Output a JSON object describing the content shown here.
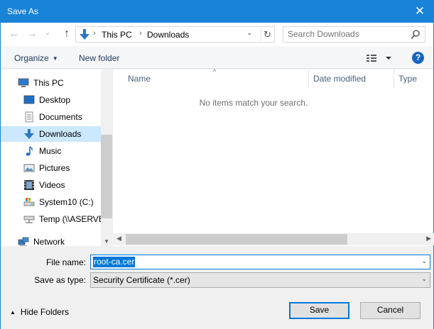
{
  "window": {
    "title": "Save As",
    "close_glyph": "✕"
  },
  "nav": {
    "back_glyph": "←",
    "forward_glyph": "→",
    "recent_glyph": "⌄",
    "up_glyph": "↑",
    "breadcrumbs": [
      "This PC",
      "Downloads"
    ],
    "breadcrumb_sep": "›",
    "dropdown_glyph": "⌄",
    "refresh_glyph": "↻"
  },
  "search": {
    "placeholder": "Search Downloads"
  },
  "toolbar": {
    "organize_label": "Organize",
    "caret": "▼",
    "new_folder_label": "New folder",
    "help_label": "?"
  },
  "navpane": {
    "items": [
      {
        "label": "This PC",
        "icon": "this-pc-icon"
      },
      {
        "label": "Desktop",
        "icon": "desktop-icon"
      },
      {
        "label": "Documents",
        "icon": "documents-icon"
      },
      {
        "label": "Downloads",
        "icon": "downloads-icon",
        "selected": true
      },
      {
        "label": "Music",
        "icon": "music-icon"
      },
      {
        "label": "Pictures",
        "icon": "pictures-icon"
      },
      {
        "label": "Videos",
        "icon": "videos-icon"
      },
      {
        "label": "System10 (C:)",
        "icon": "drive-icon"
      },
      {
        "label": "Temp (\\\\ASERVE",
        "icon": "network-drive-icon"
      },
      {
        "label": "Network",
        "icon": "network-icon"
      }
    ]
  },
  "list": {
    "columns": [
      "Name",
      "Date modified",
      "Type"
    ],
    "sort_glyph": "^",
    "empty_message": "No items match your search."
  },
  "form": {
    "file_name_label": "File name:",
    "file_name_value": "root-ca.cer",
    "save_type_label": "Save as type:",
    "save_type_value": "Security Certificate (*.cer)",
    "dropdown_glyph": "⌄"
  },
  "footer": {
    "hide_folders_label": "Hide Folders",
    "hide_caret": "▲",
    "save_label": "Save",
    "cancel_label": "Cancel"
  },
  "colors": {
    "accent": "#0078d7",
    "titlebar": "#1883d7",
    "selection": "#cce8ff"
  }
}
